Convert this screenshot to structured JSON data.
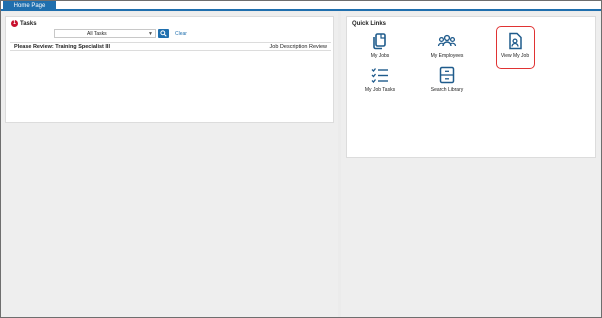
{
  "tabs": [
    {
      "label": "Home Page"
    }
  ],
  "tasks": {
    "badge_count": "1",
    "title": "Tasks",
    "filter_value": "All Tasks",
    "clear_label": "Clear",
    "rows": [
      {
        "name": "Please Review: Training Specialist III",
        "type": "Job Description Review"
      }
    ]
  },
  "quick_links": {
    "title": "Quick Links",
    "items": [
      {
        "label": "My Jobs",
        "icon": "documents-icon"
      },
      {
        "label": "My Employees",
        "icon": "people-icon"
      },
      {
        "label": "View My Job",
        "icon": "person-document-icon"
      },
      {
        "label": "My Job Tasks",
        "icon": "checklist-icon"
      },
      {
        "label": "Search Library",
        "icon": "library-icon"
      }
    ]
  },
  "colors": {
    "accent": "#1f6fae",
    "badge": "#c8102e",
    "highlight": "#e03333"
  }
}
